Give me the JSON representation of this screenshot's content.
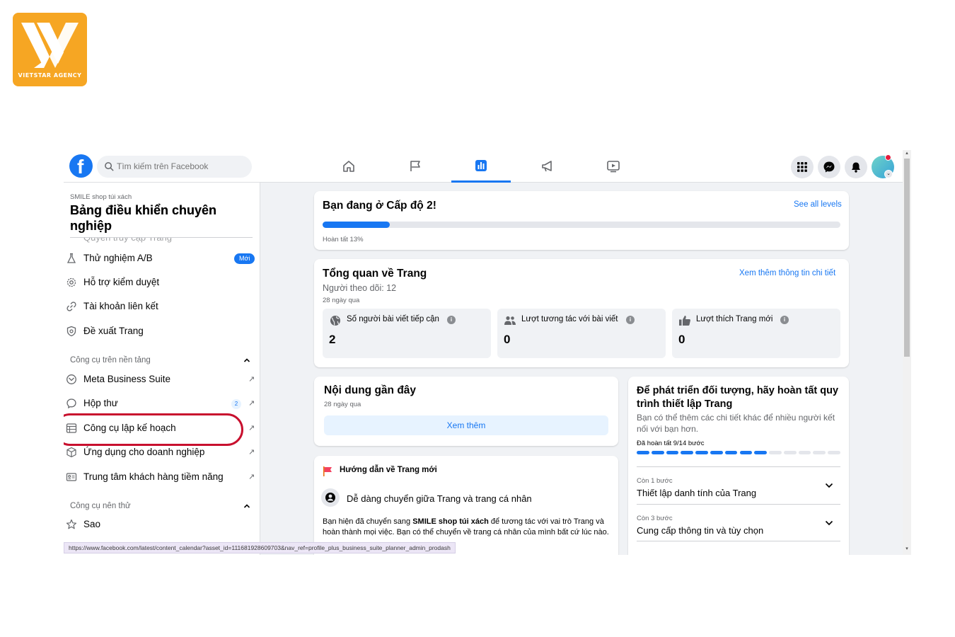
{
  "brand": {
    "logo_text": "VIETSTAR AGENCY",
    "accent_color": "#f6a623"
  },
  "topbar": {
    "search_placeholder": "Tìm kiếm trên Facebook",
    "nav_icons": [
      "home-icon",
      "flag-icon",
      "bar-chart-icon",
      "megaphone-icon",
      "video-icon"
    ],
    "active_tab": "bar-chart-icon",
    "right_icons": [
      "menu-grid-icon",
      "messenger-icon",
      "bell-icon",
      "avatar"
    ]
  },
  "sidebar": {
    "page_name": "SMILE shop túi xách",
    "title": "Bảng điều khiển chuyên nghiệp",
    "cut_off_item": "Quyền truy cập Trang",
    "items": [
      {
        "label": "Thử nghiệm A/B",
        "badge": "Mới",
        "icon": "flask-icon"
      },
      {
        "label": "Hỗ trợ kiểm duyệt",
        "icon": "gear-shield-icon"
      },
      {
        "label": "Tài khoản liên kết",
        "icon": "link-icon"
      },
      {
        "label": "Đề xuất Trang",
        "icon": "shield-icon"
      }
    ],
    "section1": "Công cụ trên nền tảng",
    "tools": [
      {
        "label": "Meta Business Suite",
        "icon": "business-suite-icon"
      },
      {
        "label": "Hộp thư",
        "count": "2",
        "icon": "chat-bubble-icon"
      },
      {
        "label": "Công cụ lập kế hoạch",
        "icon": "calendar-table-icon"
      },
      {
        "label": "Ứng dụng cho doanh nghiệp",
        "icon": "cube-icon"
      },
      {
        "label": "Trung tâm khách hàng tiềm năng",
        "icon": "id-card-icon"
      }
    ],
    "section2": "Công cụ nên thử",
    "extra": [
      {
        "label": "Sao",
        "icon": "star-icon"
      }
    ]
  },
  "level_card": {
    "title": "Bạn đang ở Cấp độ 2!",
    "link": "See all levels",
    "progress_label": "Hoàn tất 13%",
    "progress": 0.13
  },
  "overview_card": {
    "title": "Tổng quan về Trang",
    "followers": "Người theo dõi: 12",
    "period": "28 ngày qua",
    "link": "Xem thêm thông tin chi tiết",
    "stats": [
      {
        "label": "Số người bài viết tiếp cận",
        "value": "2",
        "icon": "globe-icon"
      },
      {
        "label": "Lượt tương tác với bài viết",
        "value": "0",
        "icon": "people-icon"
      },
      {
        "label": "Lượt thích Trang mới",
        "value": "0",
        "icon": "thumbs-up-icon"
      }
    ]
  },
  "recent_card": {
    "title": "Nội dung gần đây",
    "period": "28 ngày qua",
    "button": "Xem thêm"
  },
  "guide_card": {
    "header": "Hướng dẫn về Trang mới",
    "subtitle": "Dễ dàng chuyển giữa Trang và trang cá nhân",
    "body_prefix": "Bạn hiện đã chuyển sang ",
    "body_bold": "SMILE shop túi xách",
    "body_suffix": " để tương tác với vai trò Trang và hoàn thành mọi việc. Bạn có thể chuyển về trang cá nhân của mình bất cứ lúc nào."
  },
  "setup_card": {
    "title": "Để phát triển đối tượng, hãy hoàn tất quy trình thiết lập Trang",
    "desc": "Bạn có thể thêm các chi tiết khác để nhiều người kết nối với bạn hơn.",
    "progress_label": "Đã hoàn tất 9/14 bước",
    "steps_done": 9,
    "steps_total": 14,
    "rows": [
      {
        "small": "Còn 1 bước",
        "big": "Thiết lập danh tính của Trang"
      },
      {
        "small": "Còn 3 bước",
        "big": "Cung cấp thông tin và tùy chọn"
      }
    ]
  },
  "status_url": "https://www.facebook.com/latest/content_calendar?asset_id=111681928609703&nav_ref=profile_plus_business_suite_planner_admin_prodash"
}
